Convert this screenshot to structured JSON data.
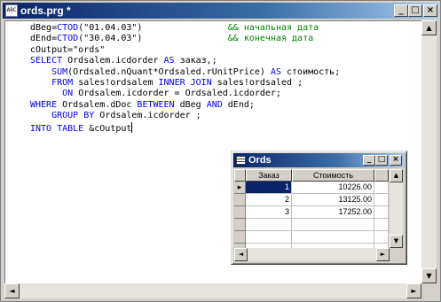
{
  "window": {
    "title": "ords.prg *",
    "icon_text": "ABC",
    "controls": {
      "minimize": "_",
      "maximize": "□",
      "close": "×"
    }
  },
  "code_lines": [
    [
      {
        "t": "dBeg="
      },
      {
        "t": "CTOD",
        "kw": true
      },
      {
        "t": "(\"01.04.03\")                "
      },
      {
        "t": "&& начальная дата",
        "cm": true
      }
    ],
    [
      {
        "t": "dEnd="
      },
      {
        "t": "CTOD",
        "kw": true
      },
      {
        "t": "(\"30.04.03\")                "
      },
      {
        "t": "&& конечная дата",
        "cm": true
      }
    ],
    [
      {
        "t": "cOutput=\"ords\""
      }
    ],
    [
      {
        "t": "SELECT",
        "kw": true
      },
      {
        "t": " Ordsalem.icdorder "
      },
      {
        "t": "AS",
        "kw": true
      },
      {
        "t": " заказ,;"
      }
    ],
    [
      {
        "t": "    "
      },
      {
        "t": "SUM",
        "kw": true
      },
      {
        "t": "(Ordsaled.nQuant*Ordsaled.rUnitPrice) "
      },
      {
        "t": "AS",
        "kw": true
      },
      {
        "t": " стоимость;"
      }
    ],
    [
      {
        "t": "    "
      },
      {
        "t": "FROM",
        "kw": true
      },
      {
        "t": " sales!ordsalem "
      },
      {
        "t": "INNER JOIN",
        "kw": true
      },
      {
        "t": " sales!ordsaled ;"
      }
    ],
    [
      {
        "t": "      "
      },
      {
        "t": "ON",
        "kw": true
      },
      {
        "t": " Ordsalem.icdorder = Ordsaled.icdorder;"
      }
    ],
    [
      {
        "t": "WHERE",
        "kw": true
      },
      {
        "t": " Ordsalem.dDoc "
      },
      {
        "t": "BETWEEN",
        "kw": true
      },
      {
        "t": " dBeg "
      },
      {
        "t": "AND",
        "kw": true
      },
      {
        "t": " dEnd;"
      }
    ],
    [
      {
        "t": "    "
      },
      {
        "t": "GROUP BY",
        "kw": true
      },
      {
        "t": " Ordsalem.icdorder ;"
      }
    ],
    [
      {
        "t": "INTO TABLE",
        "kw": true
      },
      {
        "t": " &cOutput"
      }
    ]
  ],
  "editor": {
    "caret_after_line": 9
  },
  "scrollbars": {
    "up": "▲",
    "down": "▼",
    "left": "◄",
    "right": "►"
  },
  "ords": {
    "title": "Ords",
    "controls": {
      "minimize": "_",
      "maximize": "□",
      "close": "×"
    },
    "columns": [
      "Заказ",
      "Стоимость"
    ],
    "rows": [
      {
        "order": "1",
        "cost": "10226.00"
      },
      {
        "order": "2",
        "cost": "13125.00"
      },
      {
        "order": "3",
        "cost": "17252.00"
      }
    ],
    "selected_row": 0,
    "current_row_marker": "▸"
  }
}
